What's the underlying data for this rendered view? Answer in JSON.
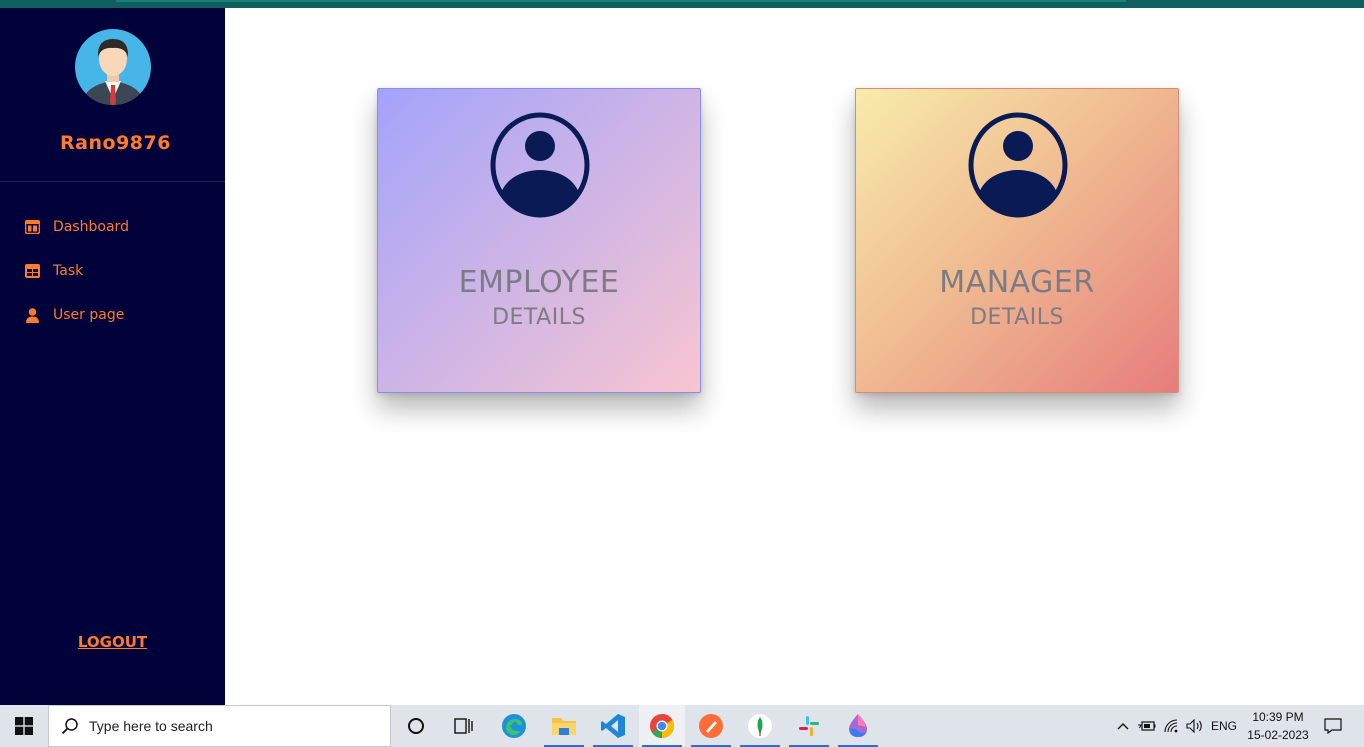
{
  "sidebar": {
    "username": "Rano9876",
    "nav": [
      {
        "label": "Dashboard",
        "icon": "dashboard-icon"
      },
      {
        "label": "Task",
        "icon": "table-icon"
      },
      {
        "label": "User page",
        "icon": "user-icon"
      }
    ],
    "logout_label": "LOGOUT"
  },
  "cards": [
    {
      "title": "EMPLOYEE",
      "subtitle": "DETAILS",
      "icon": "user-circle-icon"
    },
    {
      "title": "MANAGER",
      "subtitle": "DETAILS",
      "icon": "user-circle-icon"
    }
  ],
  "taskbar": {
    "search_placeholder": "Type here to search",
    "language": "ENG",
    "time": "10:39 PM",
    "date": "15-02-2023"
  },
  "colors": {
    "sidebar_bg": "#02023a",
    "accent": "#ff7a2f",
    "icon_navy": "#0a1a55"
  }
}
